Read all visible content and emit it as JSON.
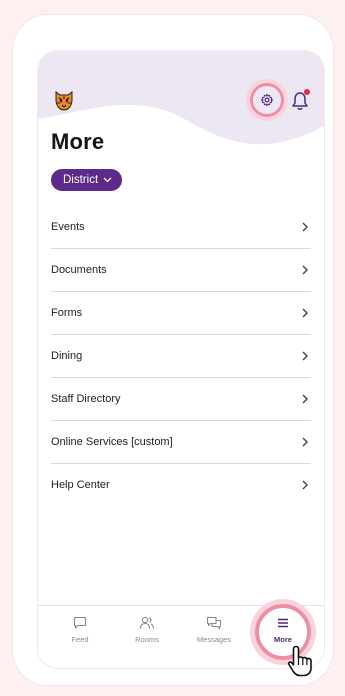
{
  "app": {
    "title": "More"
  },
  "filter": {
    "label": "District"
  },
  "menu": [
    {
      "label": "Events"
    },
    {
      "label": "Documents"
    },
    {
      "label": "Forms"
    },
    {
      "label": "Dining"
    },
    {
      "label": "Staff Directory"
    },
    {
      "label": "Online Services [custom]"
    },
    {
      "label": "Help Center"
    }
  ],
  "tabs": [
    {
      "label": "Feed",
      "icon": "chat-bubble-icon",
      "active": false
    },
    {
      "label": "Rooms",
      "icon": "people-icon",
      "active": false
    },
    {
      "label": "Messages",
      "icon": "messages-icon",
      "active": false
    },
    {
      "label": "More",
      "icon": "hamburger-menu-icon",
      "active": true
    }
  ],
  "colors": {
    "accent": "#5d2a8c",
    "highlight_ring": "#ee8ea4",
    "notification_dot": "#e0284f",
    "background": "#fdf0ef"
  }
}
